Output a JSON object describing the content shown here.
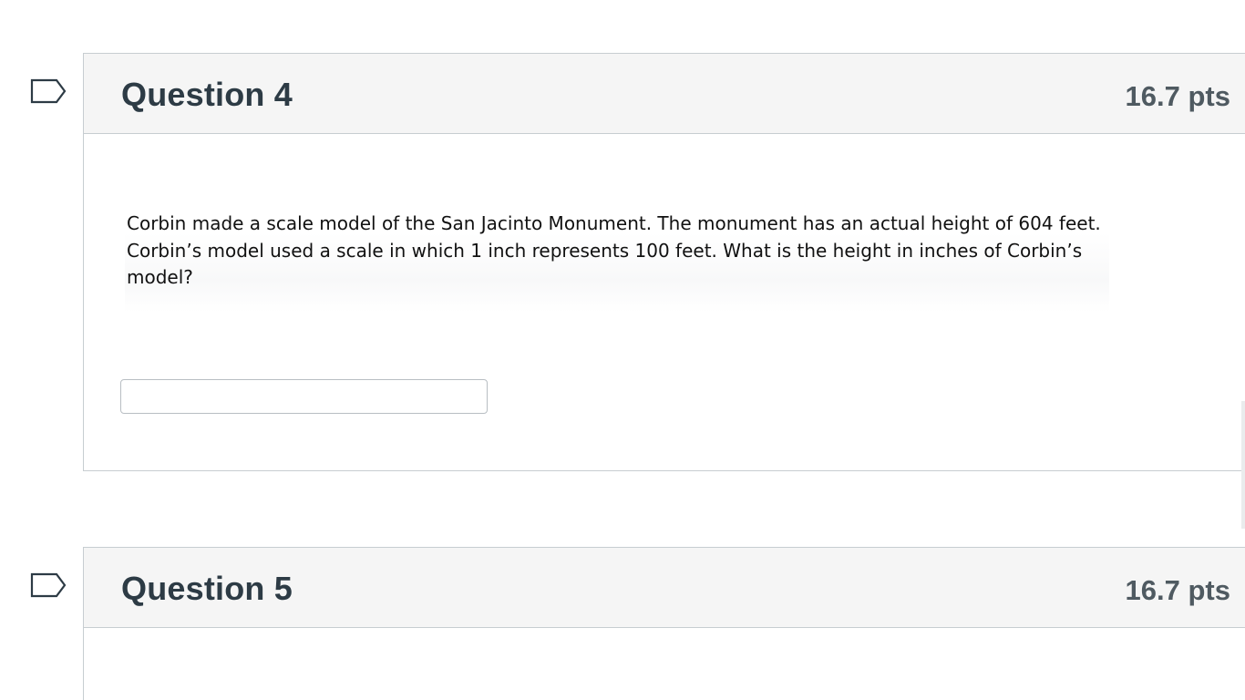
{
  "questions": [
    {
      "title": "Question 4",
      "points": "16.7 pts",
      "text": "Corbin made a scale model of the San Jacinto Monument. The monument has an actual height of 604 feet. Corbin’s model used a scale in which 1 inch represents 100 feet. What is the height in inches of Corbin’s model?",
      "answer_value": ""
    },
    {
      "title": "Question 5",
      "points": "16.7 pts"
    }
  ],
  "icons": {
    "flag": "flag-icon"
  },
  "colors": {
    "header_bg": "#f5f5f5",
    "border": "#c7cdd1",
    "title_text": "#2d3b45"
  }
}
